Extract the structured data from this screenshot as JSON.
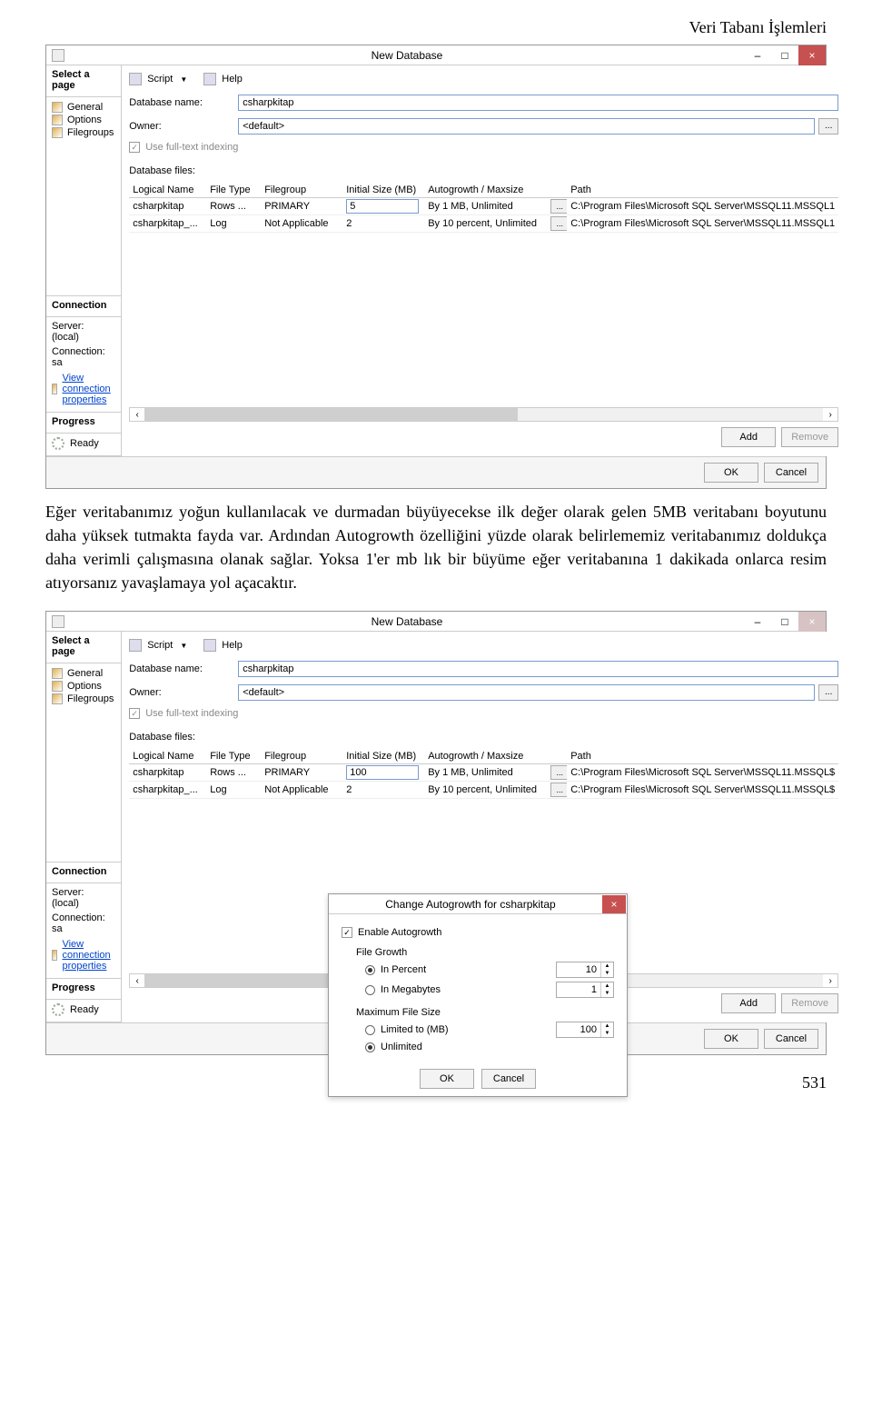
{
  "doc": {
    "header": "Veri Tabanı İşlemleri",
    "para1": "Eğer veritabanımız yoğun kullanılacak ve durmadan büyüyecekse ilk değer olarak gelen 5MB veritabanı boyutunu daha yüksek tutmakta fayda var. Ardından Autogrowth özelliğini yüzde olarak belirlememiz veritabanımız doldukça daha verimli çalışmasına olanak sağlar. Yoksa 1'er mb lık bir büyüme eğer veritabanına 1 dakikada onlarca resim atıyorsanız yavaşlamaya yol açacaktır.",
    "page_num": "531"
  },
  "dlg": {
    "title": "New Database",
    "win": {
      "min": "–",
      "max": "□",
      "close": "×"
    },
    "side": {
      "select_page": "Select a page",
      "pages": [
        "General",
        "Options",
        "Filegroups"
      ],
      "connection_h": "Connection",
      "server_l": "Server:",
      "server_v": "(local)",
      "conn_l": "Connection:",
      "conn_v": "sa",
      "viewprops": "View connection properties",
      "progress_h": "Progress",
      "ready": "Ready"
    },
    "tool": {
      "script": "Script",
      "help": "Help"
    },
    "form": {
      "dbname_l": "Database name:",
      "owner_l": "Owner:",
      "owner_v": "<default>",
      "fulltext": "Use full-text indexing",
      "dbfiles_l": "Database files:"
    },
    "grid": {
      "cols": [
        "Logical Name",
        "File Type",
        "Filegroup",
        "Initial Size (MB)",
        "Autogrowth / Maxsize",
        "",
        "Path"
      ],
      "rows1": [
        {
          "lname": "csharpkitap",
          "ftype": "Rows ...",
          "fgrp": "PRIMARY",
          "isize": "5",
          "auto": "By 1 MB, Unlimited",
          "path": "C:\\Program Files\\Microsoft SQL Server\\MSSQL11.MSSQL1"
        },
        {
          "lname": "csharpkitap_...",
          "ftype": "Log",
          "fgrp": "Not Applicable",
          "isize": "2",
          "auto": "By 10 percent, Unlimited",
          "path": "C:\\Program Files\\Microsoft SQL Server\\MSSQL11.MSSQL1"
        }
      ],
      "rows2": [
        {
          "lname": "csharpkitap",
          "ftype": "Rows ...",
          "fgrp": "PRIMARY",
          "isize": "100",
          "auto": "By 1 MB, Unlimited",
          "path": "C:\\Program Files\\Microsoft SQL Server\\MSSQL11.MSSQL$"
        },
        {
          "lname": "csharpkitap_...",
          "ftype": "Log",
          "fgrp": "Not Applicable",
          "isize": "2",
          "auto": "By 10 percent, Unlimited",
          "path": "C:\\Program Files\\Microsoft SQL Server\\MSSQL11.MSSQL$"
        }
      ]
    },
    "dbname1": "csharpkitap",
    "dbname2": "csharpkitap",
    "addremove": {
      "add": "Add",
      "remove": "Remove"
    },
    "okcancel": {
      "ok": "OK",
      "cancel": "Cancel"
    }
  },
  "ov": {
    "title": "Change Autogrowth for csharpkitap",
    "enable": "Enable Autogrowth",
    "fg_h": "File Growth",
    "fg_percent": "In Percent",
    "fg_mb": "In Megabytes",
    "fg_percent_v": "10",
    "fg_mb_v": "1",
    "mfs_h": "Maximum File Size",
    "mfs_limited": "Limited to (MB)",
    "mfs_unlimited": "Unlimited",
    "mfs_limited_v": "100",
    "ok": "OK",
    "cancel": "Cancel"
  }
}
